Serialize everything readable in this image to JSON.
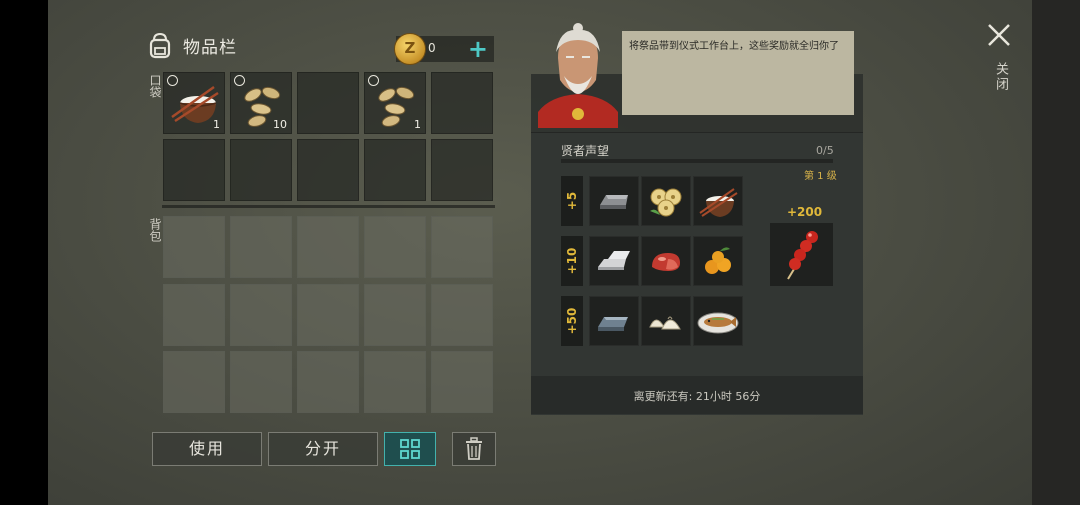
{
  "inventory": {
    "title": "物品栏",
    "coins": "0",
    "pocket_label": "口袋",
    "backpack_label": "背包",
    "pocket_slots": [
      {
        "item": "rice-bowl",
        "qty": "1"
      },
      {
        "item": "seeds",
        "qty": "10"
      },
      {
        "item": "",
        "qty": ""
      },
      {
        "item": "seeds",
        "qty": "1"
      },
      {
        "item": "",
        "qty": ""
      }
    ]
  },
  "buttons": {
    "use": "使用",
    "split": "分开"
  },
  "npc": {
    "speech": "将祭品带到仪式工作台上，这些奖励就全归你了",
    "reputation_label": "贤者声望",
    "reputation_count": "0/5",
    "level": "第 1 级",
    "tiers": [
      "+5",
      "+10",
      "+50"
    ],
    "reward_value": "+200",
    "refresh": "离更新还有:  21小时 56分"
  },
  "close_label": "关闭",
  "colors": {
    "accent_teal": "#43b2ad",
    "gold": "#e0b83a"
  }
}
